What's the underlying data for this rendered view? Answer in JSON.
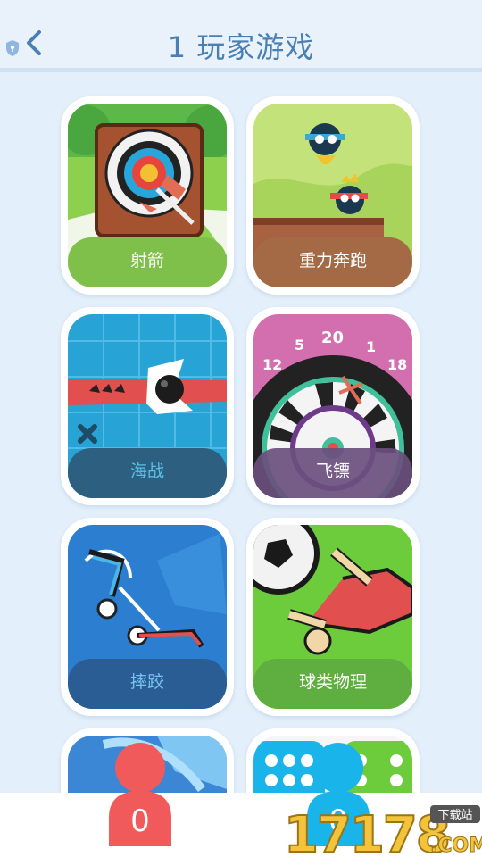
{
  "header": {
    "title": "1 玩家游戏"
  },
  "games": [
    {
      "label": "射箭",
      "color": "#7ec04a"
    },
    {
      "label": "重力奔跑",
      "color": "#a36a45"
    },
    {
      "label": "海战",
      "color": "#2d5f80"
    },
    {
      "label": "飞镖",
      "color": "#6a4f7e"
    },
    {
      "label": "摔跤",
      "color": "#2a5d93"
    },
    {
      "label": "球类物理",
      "color": "#5fae40"
    }
  ],
  "players": {
    "red": {
      "count": "0",
      "color": "#f05a5a"
    },
    "blue": {
      "count": "0",
      "color": "#19b5ea"
    }
  },
  "watermark": {
    "number": "17178",
    "badge": "下载站",
    "domain": ".COM"
  }
}
